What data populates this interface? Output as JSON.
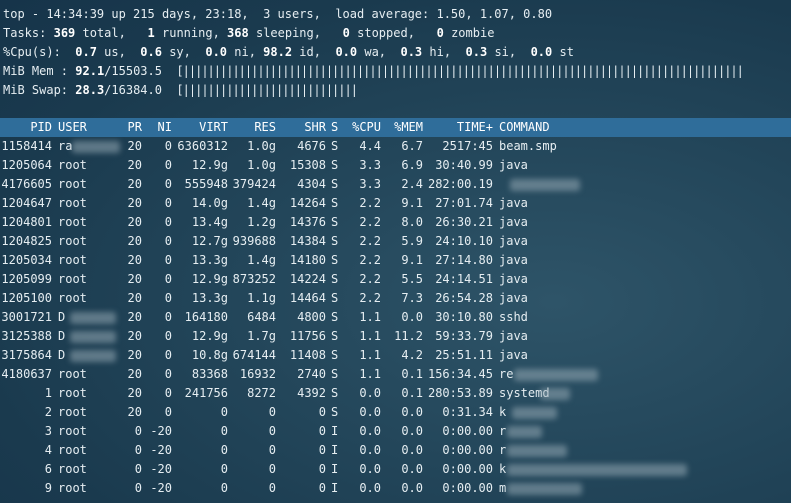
{
  "summary": {
    "uptime_line": "top - 14:34:39 up 215 days, 23:18,  3 users,  load average: 1.50, 1.07, 0.80",
    "tasks": {
      "label": "Tasks:",
      "total": "369",
      "total_label": " total,",
      "running": "1",
      "running_label": " running,",
      "sleeping": "368",
      "sleeping_label": " sleeping,",
      "stopped": "0",
      "stopped_label": " stopped,",
      "zombie": "0",
      "zombie_label": " zombie"
    },
    "cpu": {
      "label": "%Cpu(s):",
      "us": "0.7",
      "us_label": " us,",
      "sy": "0.6",
      "sy_label": " sy,",
      "ni": "0.0",
      "ni_label": " ni,",
      "id": "98.2",
      "id_label": " id,",
      "wa": "0.0",
      "wa_label": " wa,",
      "hi": "0.3",
      "hi_label": " hi,",
      "si": "0.3",
      "si_label": " si,",
      "st": "0.0",
      "st_label": " st"
    },
    "mem": {
      "label": "MiB Mem :",
      "used": "92.1",
      "total": "/15503.5",
      "bar": "[||||||||||||||||||||||||||||||||||||||||||||||||||||||||||||||||||||||||||||||||||||||||||"
    },
    "swap": {
      "label": "MiB Swap:",
      "used": "28.3",
      "total": "/16384.0",
      "bar": "[||||||||||||||||||||||||||||"
    }
  },
  "columns": [
    "PID",
    "USER",
    "PR",
    "NI",
    "VIRT",
    "RES",
    "SHR",
    "S",
    "%CPU",
    "%MEM",
    "TIME+",
    "COMMAND"
  ],
  "processes": [
    {
      "pid": "1158414",
      "user": "ra",
      "pr": "20",
      "ni": "0",
      "virt": "6360312",
      "res": "1.0g",
      "shr": "4676",
      "s": "S",
      "cpu": "4.4",
      "mem": "6.7",
      "time": "2517:45",
      "cmd": "beam.smp"
    },
    {
      "pid": "1205064",
      "user": "root",
      "pr": "20",
      "ni": "0",
      "virt": "12.9g",
      "res": "1.0g",
      "shr": "15308",
      "s": "S",
      "cpu": "3.3",
      "mem": "6.9",
      "time": "30:40.99",
      "cmd": "java"
    },
    {
      "pid": "4176605",
      "user": "root",
      "pr": "20",
      "ni": "0",
      "virt": "555948",
      "res": "379424",
      "shr": "4304",
      "s": "S",
      "cpu": "3.3",
      "mem": "2.4",
      "time": "282:00.19",
      "cmd": ""
    },
    {
      "pid": "1204647",
      "user": "root",
      "pr": "20",
      "ni": "0",
      "virt": "14.0g",
      "res": "1.4g",
      "shr": "14264",
      "s": "S",
      "cpu": "2.2",
      "mem": "9.1",
      "time": "27:01.74",
      "cmd": "java"
    },
    {
      "pid": "1204801",
      "user": "root",
      "pr": "20",
      "ni": "0",
      "virt": "13.4g",
      "res": "1.2g",
      "shr": "14376",
      "s": "S",
      "cpu": "2.2",
      "mem": "8.0",
      "time": "26:30.21",
      "cmd": "java"
    },
    {
      "pid": "1204825",
      "user": "root",
      "pr": "20",
      "ni": "0",
      "virt": "12.7g",
      "res": "939688",
      "shr": "14384",
      "s": "S",
      "cpu": "2.2",
      "mem": "5.9",
      "time": "24:10.10",
      "cmd": "java"
    },
    {
      "pid": "1205034",
      "user": "root",
      "pr": "20",
      "ni": "0",
      "virt": "13.3g",
      "res": "1.4g",
      "shr": "14180",
      "s": "S",
      "cpu": "2.2",
      "mem": "9.1",
      "time": "27:14.80",
      "cmd": "java"
    },
    {
      "pid": "1205099",
      "user": "root",
      "pr": "20",
      "ni": "0",
      "virt": "12.9g",
      "res": "873252",
      "shr": "14224",
      "s": "S",
      "cpu": "2.2",
      "mem": "5.5",
      "time": "24:14.51",
      "cmd": "java"
    },
    {
      "pid": "1205100",
      "user": "root",
      "pr": "20",
      "ni": "0",
      "virt": "13.3g",
      "res": "1.1g",
      "shr": "14464",
      "s": "S",
      "cpu": "2.2",
      "mem": "7.3",
      "time": "26:54.28",
      "cmd": "java"
    },
    {
      "pid": "3001721",
      "user": "D",
      "pr": "20",
      "ni": "0",
      "virt": "164180",
      "res": "6484",
      "shr": "4800",
      "s": "S",
      "cpu": "1.1",
      "mem": "0.0",
      "time": "30:10.80",
      "cmd": "sshd"
    },
    {
      "pid": "3125388",
      "user": "D",
      "pr": "20",
      "ni": "0",
      "virt": "12.9g",
      "res": "1.7g",
      "shr": "11756",
      "s": "S",
      "cpu": "1.1",
      "mem": "11.2",
      "time": "59:33.79",
      "cmd": "java"
    },
    {
      "pid": "3175864",
      "user": "D",
      "pr": "20",
      "ni": "0",
      "virt": "10.8g",
      "res": "674144",
      "shr": "11408",
      "s": "S",
      "cpu": "1.1",
      "mem": "4.2",
      "time": "25:51.11",
      "cmd": "java"
    },
    {
      "pid": "4180637",
      "user": "root",
      "pr": "20",
      "ni": "0",
      "virt": "83368",
      "res": "16932",
      "shr": "2740",
      "s": "S",
      "cpu": "1.1",
      "mem": "0.1",
      "time": "156:34.45",
      "cmd": "re"
    },
    {
      "pid": "1",
      "user": "root",
      "pr": "20",
      "ni": "0",
      "virt": "241756",
      "res": "8272",
      "shr": "4392",
      "s": "S",
      "cpu": "0.0",
      "mem": "0.1",
      "time": "280:53.89",
      "cmd": "systemd"
    },
    {
      "pid": "2",
      "user": "root",
      "pr": "20",
      "ni": "0",
      "virt": "0",
      "res": "0",
      "shr": "0",
      "s": "S",
      "cpu": "0.0",
      "mem": "0.0",
      "time": "0:31.34",
      "cmd": "k"
    },
    {
      "pid": "3",
      "user": "root",
      "pr": "0",
      "ni": "-20",
      "virt": "0",
      "res": "0",
      "shr": "0",
      "s": "I",
      "cpu": "0.0",
      "mem": "0.0",
      "time": "0:00.00",
      "cmd": "r"
    },
    {
      "pid": "4",
      "user": "root",
      "pr": "0",
      "ni": "-20",
      "virt": "0",
      "res": "0",
      "shr": "0",
      "s": "I",
      "cpu": "0.0",
      "mem": "0.0",
      "time": "0:00.00",
      "cmd": "r"
    },
    {
      "pid": "6",
      "user": "root",
      "pr": "0",
      "ni": "-20",
      "virt": "0",
      "res": "0",
      "shr": "0",
      "s": "I",
      "cpu": "0.0",
      "mem": "0.0",
      "time": "0:00.00",
      "cmd": "k"
    },
    {
      "pid": "9",
      "user": "root",
      "pr": "0",
      "ni": "-20",
      "virt": "0",
      "res": "0",
      "shr": "0",
      "s": "I",
      "cpu": "0.0",
      "mem": "0.0",
      "time": "0:00.00",
      "cmd": "m"
    }
  ],
  "colors": {
    "header_bg": "#2f6d9a",
    "terminal_bg": "#1f4255",
    "text": "#e6eef2"
  }
}
